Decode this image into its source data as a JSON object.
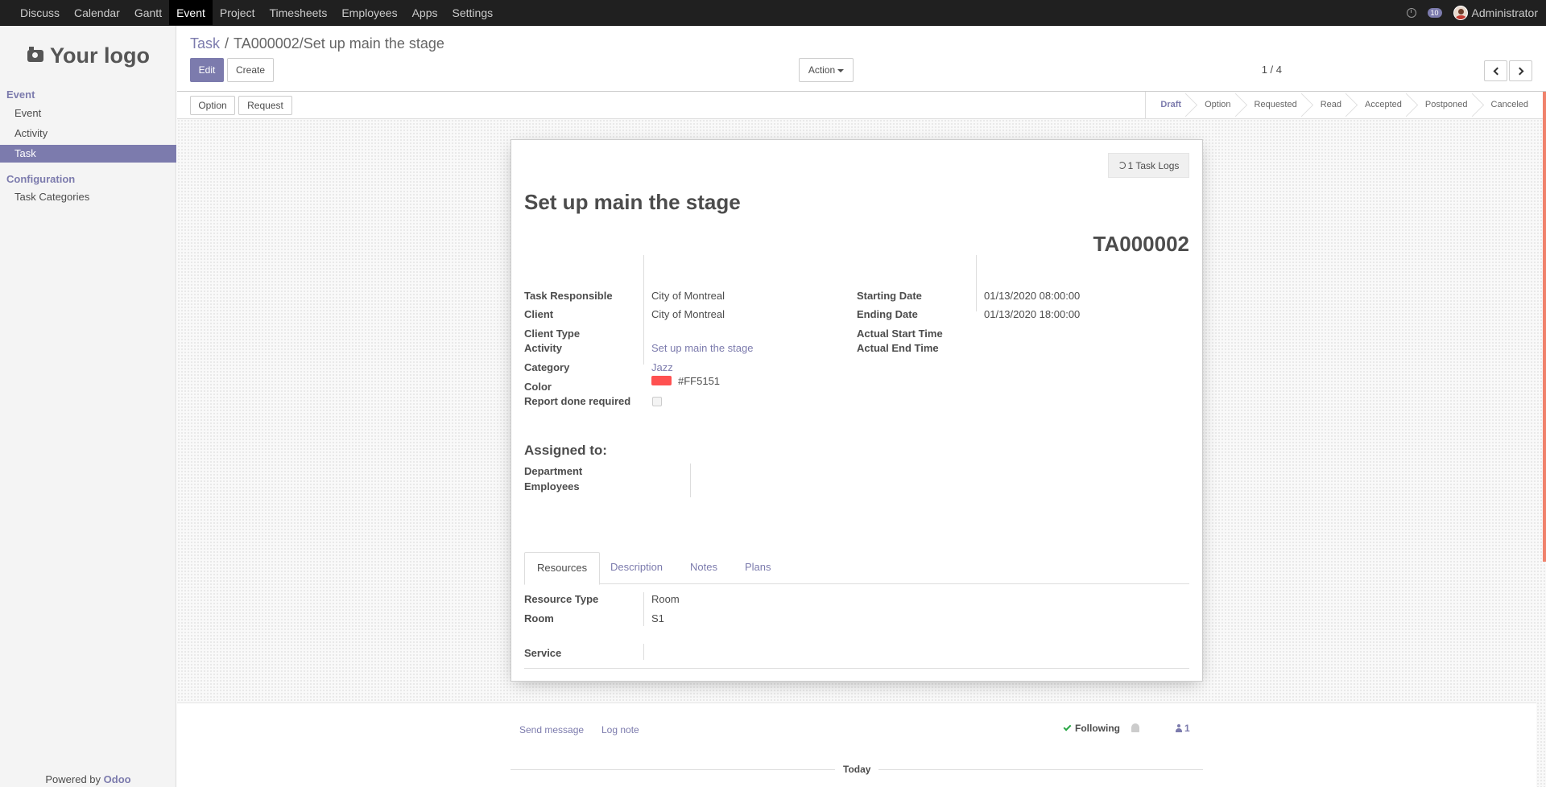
{
  "topbar": {
    "menu": [
      "Discuss",
      "Calendar",
      "Gantt",
      "Event",
      "Project",
      "Timesheets",
      "Employees",
      "Apps",
      "Settings"
    ],
    "active_menu": "Event",
    "message_count": "10",
    "user_name": "Administrator"
  },
  "sidebar": {
    "logo_text": "Your logo",
    "section_event": "Event",
    "items_event": [
      "Event",
      "Activity",
      "Task"
    ],
    "active_item": "Task",
    "section_config": "Configuration",
    "items_config": [
      "Task Categories"
    ],
    "powered_prefix": "Powered by",
    "powered_brand": "Odoo"
  },
  "control": {
    "breadcrumb_parent": "Task",
    "breadcrumb_sep": "/",
    "breadcrumb_current": "TA000002/Set up main the stage",
    "edit_label": "Edit",
    "create_label": "Create",
    "action_label": "Action",
    "pager": "1 / 4"
  },
  "statusbar": {
    "option_label": "Option",
    "request_label": "Request",
    "stages": [
      "Draft",
      "Option",
      "Requested",
      "Read",
      "Accepted",
      "Postponed",
      "Canceled"
    ],
    "active_stage": "Draft"
  },
  "form": {
    "smart_button": "1 Task Logs",
    "title": "Set up main the stage",
    "code": "TA000002",
    "left_fields": {
      "task_responsible_label": "Task Responsible",
      "task_responsible": "City of Montreal",
      "client_label": "Client",
      "client": "City of Montreal",
      "client_type_label": "Client Type",
      "activity_label": "Activity",
      "activity": "Set up main the stage",
      "category_label": "Category",
      "category": "Jazz",
      "color_label": "Color",
      "color": "#FF5151",
      "report_label": "Report done required"
    },
    "right_fields": {
      "starting_date_label": "Starting Date",
      "starting_date": "01/13/2020 08:00:00",
      "ending_date_label": "Ending Date",
      "ending_date": "01/13/2020 18:00:00",
      "actual_start_label": "Actual Start Time",
      "actual_end_label": "Actual End Time"
    },
    "assigned_heading": "Assigned to:",
    "department_label": "Department",
    "employees_label": "Employees",
    "tabs": [
      "Resources",
      "Description",
      "Notes",
      "Plans"
    ],
    "active_tab": "Resources",
    "resources": {
      "resource_type_label": "Resource Type",
      "resource_type": "Room",
      "room_label": "Room",
      "room": "S1",
      "service_label": "Service"
    }
  },
  "chatter": {
    "send_message": "Send message",
    "log_note": "Log note",
    "following": "Following",
    "followers_count": "1",
    "today": "Today"
  },
  "colors": {
    "accent": "#7c7bad",
    "topbar": "#202020",
    "swatch": "#ff5151"
  }
}
